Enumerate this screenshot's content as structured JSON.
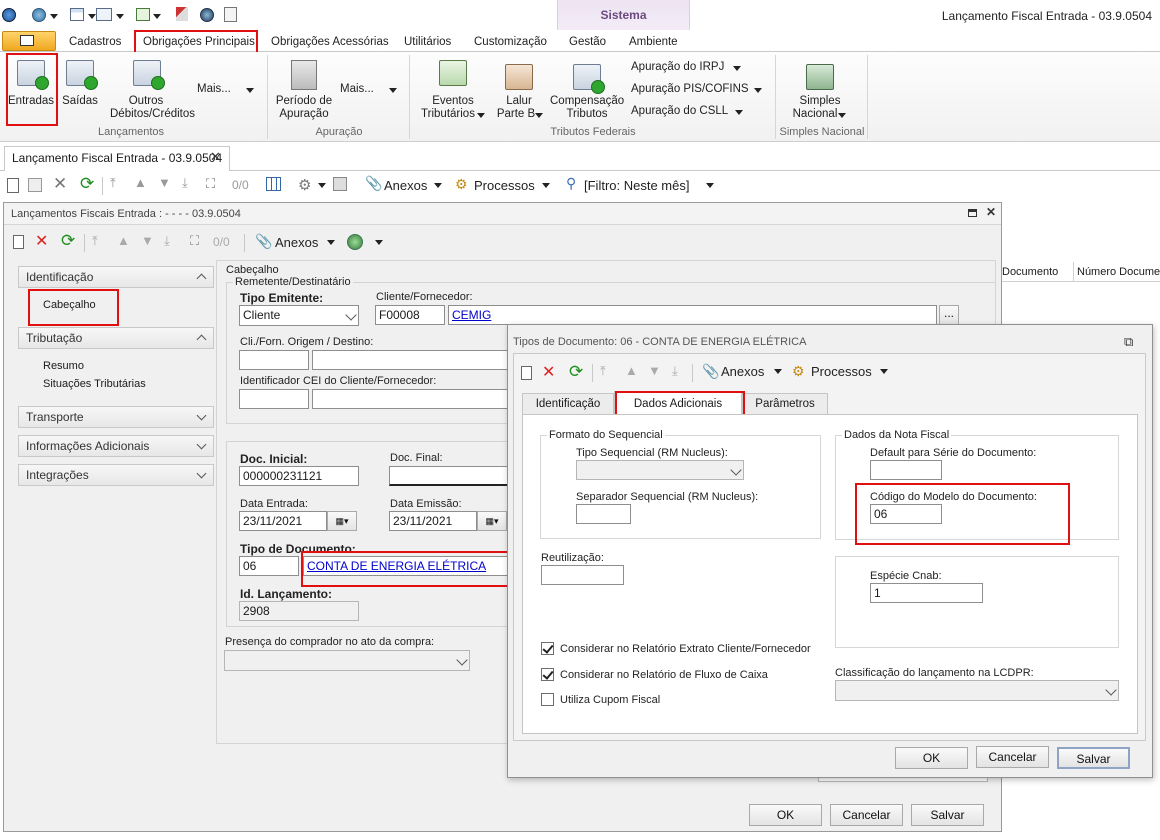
{
  "titlebar": {
    "title": "Lançamento Fiscal Entrada - 03.9.0504",
    "context_tab": "Sistema"
  },
  "ribbon": {
    "tabs": [
      "Cadastros",
      "Obrigações Principais",
      "Obrigações Acessórias",
      "Utilitários",
      "Customização",
      "Gestão",
      "Ambiente"
    ],
    "lancamentos": {
      "entradas": "Entradas",
      "saidas": "Saídas",
      "outros_1": "Outros",
      "outros_2": "Débitos/Créditos",
      "mais": "Mais...",
      "group": "Lançamentos"
    },
    "apuracao": {
      "periodo_1": "Período de",
      "periodo_2": "Apuração",
      "mais": "Mais...",
      "group": "Apuração"
    },
    "tributos": {
      "eventos_1": "Eventos",
      "eventos_2": "Tributários",
      "lalur_1": "Lalur",
      "lalur_2": "Parte B",
      "comp_1": "Compensação",
      "comp_2": "Tributos",
      "irpj": "Apuração do IRPJ",
      "pis": "Apuração PIS/COFINS",
      "csll": "Apuração do CSLL",
      "group": "Tributos Federais"
    },
    "simples": {
      "label_1": "Simples",
      "label_2": "Nacional",
      "group": "Simples Nacional"
    }
  },
  "doc_tab": {
    "label": "Lançamento Fiscal Entrada - 03.9.0504"
  },
  "main_toolbar": {
    "count": "0/0",
    "anexos": "Anexos",
    "processos": "Processos",
    "filtro": "[Filtro: Neste mês]"
  },
  "grid_headers": [
    "Documento",
    "Número Documen"
  ],
  "form": {
    "title": "Lançamentos Fiscais Entrada : - - - - 03.9.0504",
    "toolbar": {
      "count": "0/0",
      "anexos": "Anexos"
    },
    "nav": {
      "identificacao": "Identificação",
      "cabecalho": "Cabeçalho",
      "tributacao": "Tributação",
      "resumo": "Resumo",
      "situacoes": "Situações Tributárias",
      "transporte": "Transporte",
      "info_adicionais": "Informações Adicionais",
      "integracoes": "Integrações"
    },
    "section_title": "Cabeçalho",
    "group_title": "Remetente/Destinatário",
    "tipo_emitente_label": "Tipo Emitente:",
    "tipo_emitente_value": "Cliente",
    "cliente_label": "Cliente/Fornecedor:",
    "cliente_code": "F00008",
    "cliente_name": "CEMIG",
    "ellipsis": "...",
    "origem_label": "Cli./Forn. Origem / Destino:",
    "cei_label": "Identificador CEI do Cliente/Fornecedor:",
    "doc_inicial_label": "Doc. Inicial:",
    "doc_inicial_value": "000000231121",
    "doc_final_label": "Doc. Final:",
    "data_entrada_label": "Data Entrada:",
    "data_entrada_value": "23/11/2021",
    "data_emissao_label": "Data Emissão:",
    "data_emissao_value": "23/11/2021",
    "tipo_doc_label": "Tipo de Documento:",
    "tipo_doc_code": "06",
    "tipo_doc_name": "CONTA DE ENERGIA ELÉTRICA",
    "id_lanc_label": "Id. Lançamento:",
    "id_lanc_value": "2908",
    "presenca_label": "Presença do comprador no ato da compra:",
    "ok": "OK",
    "cancelar": "Cancelar",
    "salvar": "Salvar"
  },
  "dialog": {
    "title": "Tipos de Documento: 06 - CONTA DE ENERGIA ELÉTRICA",
    "toolbar": {
      "anexos": "Anexos",
      "processos": "Processos"
    },
    "tabs": [
      "Identificação",
      "Dados Adicionais",
      "Parâmetros"
    ],
    "formato_title": "Formato do Sequencial",
    "tipo_seq_label": "Tipo Sequencial (RM Nucleus):",
    "separador_label": "Separador Sequencial (RM Nucleus):",
    "reutilizacao_label": "Reutilização:",
    "dados_nf_title": "Dados da Nota Fiscal",
    "default_serie_label": "Default para Série do Documento:",
    "codigo_modelo_label": "Código do Modelo do Documento:",
    "codigo_modelo_value": "06",
    "especie_label": "Espécie Cnab:",
    "especie_value": "1",
    "chk1": "Considerar no Relatório Extrato Cliente/Fornecedor",
    "chk2": "Considerar no Relatório de Fluxo de Caixa",
    "chk3": "Utiliza Cupom Fiscal",
    "classificacao_label": "Classificação do lançamento na LCDPR:",
    "ok": "OK",
    "cancelar": "Cancelar",
    "salvar": "Salvar"
  }
}
